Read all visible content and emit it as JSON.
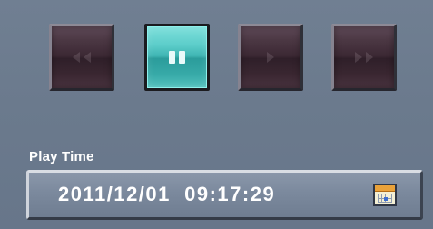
{
  "playback": {
    "buttons": [
      {
        "icon": "rewind-icon",
        "state": "inactive"
      },
      {
        "icon": "pause-icon",
        "state": "active"
      },
      {
        "icon": "play-icon",
        "state": "inactive"
      },
      {
        "icon": "fast-forward-icon",
        "state": "inactive"
      }
    ]
  },
  "play_time": {
    "label": "Play Time",
    "value": "2011/12/01  09:17:29",
    "calendar_icon": "calendar-icon"
  },
  "colors": {
    "background": "#6f7e91",
    "active_button": "#4fc3c0",
    "inactive_button": "#3b2833",
    "text": "#ffffff"
  }
}
